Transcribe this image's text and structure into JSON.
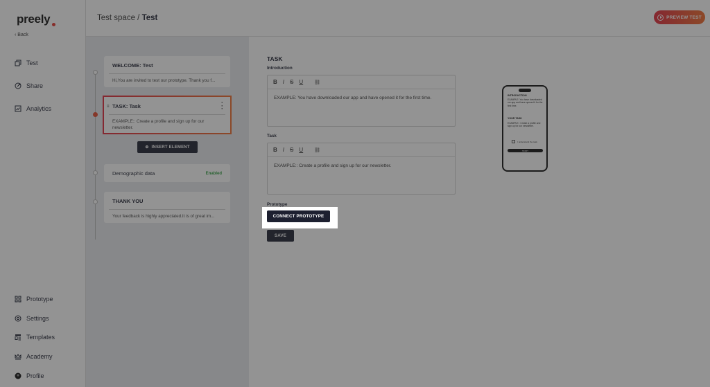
{
  "brand": {
    "name": "preely",
    "accent": "#e5322d"
  },
  "sidebar": {
    "back_label": "Back",
    "top_items": [
      {
        "label": "Test",
        "icon": "test-icon"
      },
      {
        "label": "Share",
        "icon": "share-icon"
      },
      {
        "label": "Analytics",
        "icon": "analytics-icon"
      }
    ],
    "bottom_items": [
      {
        "label": "Prototype",
        "icon": "grid-icon"
      },
      {
        "label": "Settings",
        "icon": "gear-icon"
      },
      {
        "label": "Templates",
        "icon": "templates-icon"
      },
      {
        "label": "Academy",
        "icon": "crown-icon"
      },
      {
        "label": "Profile",
        "icon": "avatar-icon"
      }
    ]
  },
  "header": {
    "breadcrumb_parent": "Test space /",
    "breadcrumb_current": "Test",
    "preview_label": "PREVIEW TEST"
  },
  "flow": {
    "welcome": {
      "title": "WELCOME:  Test",
      "body": "Hi,You are invited to test our prototype. Thank you f..."
    },
    "task": {
      "title": "TASK:  Task",
      "body": "EXAMPLE:: Create a profile and sign up for our newsletter."
    },
    "insert_label": "INSERT ELEMENT",
    "demographic": {
      "title": "Demographic data",
      "status": "Enabled"
    },
    "thankyou": {
      "title": "THANK YOU",
      "body": "Your feedback is highly appreciated.It is of great im..."
    }
  },
  "editor": {
    "section_title": "TASK",
    "intro_label": "Introduction",
    "intro_text": "EXAMPLE: You have downloaded our app and have opened it for the first time.",
    "task_label": "Task",
    "task_text": "EXAMPLE:: Create a profile and sign up for our newsletter.",
    "toolbar": {
      "bold": "B",
      "italic": "I",
      "strike": "S",
      "underline": "U",
      "link": "🔗"
    },
    "prototype_label": "Prototype",
    "connect_label": "CONNECT PROTOTYPE",
    "save_label": "SAVE"
  },
  "phone_preview": {
    "intro_heading": "INTRODUCTION",
    "intro_text": "EXAMPLE: You have downloaded our app and have opened it for the first time.",
    "task_heading": "YOUR TASK",
    "task_text": "EXAMPLE:: Create a profile and sign up for our newsletter.",
    "checkbox_label": "I understand the task",
    "start_label": "START"
  }
}
